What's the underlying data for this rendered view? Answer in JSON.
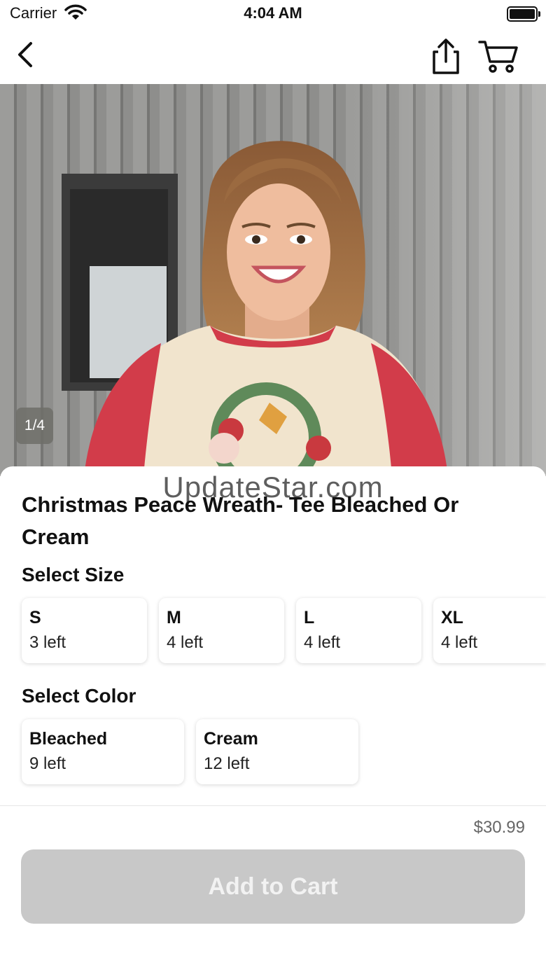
{
  "status_bar": {
    "carrier": "Carrier",
    "time": "4:04 AM"
  },
  "gallery": {
    "counter": "1/4"
  },
  "watermark": "UpdateStar.com",
  "product": {
    "title": "Christmas Peace Wreath- Tee Bleached Or Cream",
    "price": "$30.99"
  },
  "size_section": {
    "label": "Select Size",
    "options": [
      {
        "name": "S",
        "stock": "3 left"
      },
      {
        "name": "M",
        "stock": "4 left"
      },
      {
        "name": "L",
        "stock": "4 left"
      },
      {
        "name": "XL",
        "stock": "4 left"
      }
    ]
  },
  "color_section": {
    "label": "Select Color",
    "options": [
      {
        "name": "Bleached",
        "stock": "9 left"
      },
      {
        "name": "Cream",
        "stock": "12 left"
      }
    ]
  },
  "add_to_cart_label": "Add to Cart",
  "icons": [
    "wifi-icon",
    "battery-icon",
    "back-chevron-icon",
    "share-icon",
    "cart-icon"
  ],
  "colors": {
    "button_disabled": "#c8c8c8",
    "shirt_red": "#d23c4a",
    "shirt_cream": "#f1e4cd"
  }
}
